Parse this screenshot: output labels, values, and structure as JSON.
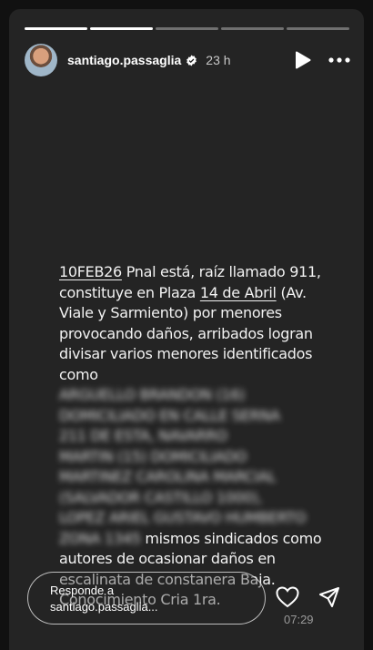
{
  "story": {
    "username": "santiago.passaglia",
    "time_ago": "23 h",
    "progress_segments": [
      {
        "state": "done"
      },
      {
        "state": "done"
      },
      {
        "state": "pending"
      },
      {
        "state": "pending"
      },
      {
        "state": "pending"
      }
    ]
  },
  "text": {
    "date_tag": "10FEB26",
    "part1": " Pnal está, raíz llamado 911, constituye en Plaza ",
    "place_link": "14 de Abril",
    "part2": " (Av. Viale y Sarmiento) por menores provocando daños, arribados logran divisar varios menores identificados como",
    "redacted_1": "ARGUELLO BRANDON (16)",
    "redacted_2": "DOMICILIADO EN CALLE SERNA",
    "redacted_3": "211 DE ESTA, NAVARRO",
    "redacted_4": "MARTIN (15) DOMICILIADO",
    "redacted_5": "MARTINEZ CAROLINA MARCIAL",
    "redacted_6": "(SALVADOR CASTILLO 1000),",
    "redacted_7": "LOPEZ ARIEL GUSTAVO HUMBERTO",
    "redacted_8": "ZONA 1345",
    "part3": " mismos sindicados como autores de ocasionar daños en escalinata de constanera Baja. Conocimiento Cria 1ra."
  },
  "reply": {
    "placeholder_line1": "Responde a",
    "placeholder_line2": "santiago.passaglia..."
  },
  "clock": "07:29",
  "icons": {
    "verified": "verified-badge-icon",
    "play": "play-icon",
    "more": "more-options-icon",
    "like": "heart-icon",
    "share": "send-icon"
  }
}
